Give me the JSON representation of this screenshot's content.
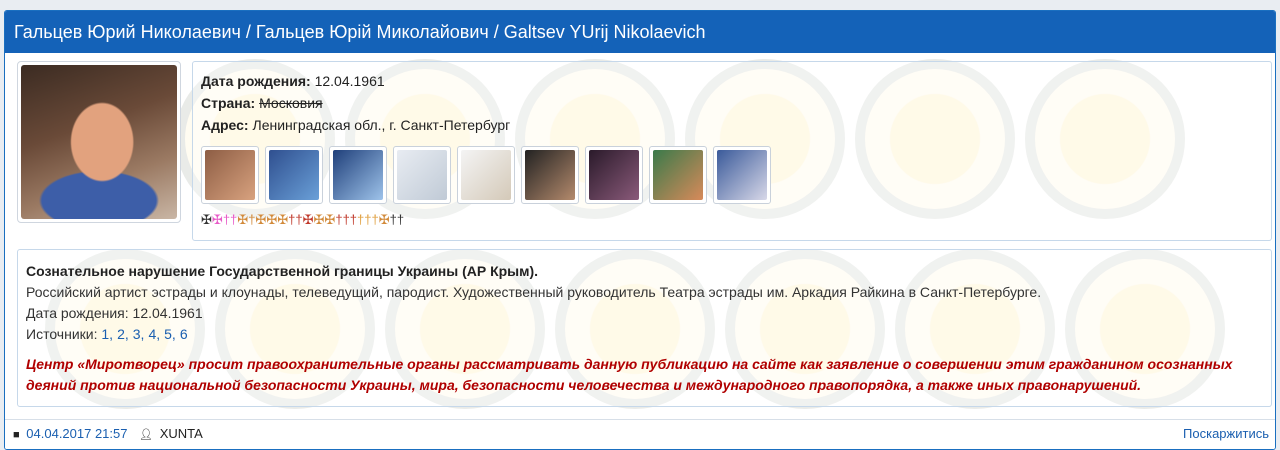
{
  "header": {
    "title": "Гальцев Юрий Николаевич / Гальцев Юрій Миколайович / Galtsev YUrij Nikolaevich"
  },
  "profile": {
    "birth_label": "Дата рождения:",
    "birth_value": "12.04.1961",
    "country_label": "Страна:",
    "country_value": "Московия",
    "address_label": "Адрес:",
    "address_value": "Ленинградская обл., г. Санкт-Петербург"
  },
  "thumbnails": [
    {
      "name": "photo-thumb-1",
      "color_a": "#8d5d44",
      "color_b": "#d8a27f"
    },
    {
      "name": "photo-thumb-2",
      "color_a": "#2f4f8f",
      "color_b": "#6aa0d8"
    },
    {
      "name": "photo-thumb-3",
      "color_a": "#1f3f7a",
      "color_b": "#9ec3ea"
    },
    {
      "name": "doc-thumb-4",
      "color_a": "#e8ecf2",
      "color_b": "#c0cad6"
    },
    {
      "name": "doc-thumb-5",
      "color_a": "#f4f4f4",
      "color_b": "#d4c9b8"
    },
    {
      "name": "photo-thumb-6",
      "color_a": "#222222",
      "color_b": "#b48a6c"
    },
    {
      "name": "photo-thumb-7",
      "color_a": "#2a1a2a",
      "color_b": "#8a5a7a"
    },
    {
      "name": "photo-thumb-8",
      "color_a": "#3a7a4a",
      "color_b": "#d88a5a"
    },
    {
      "name": "photo-thumb-9",
      "color_a": "#3a5a9a",
      "color_b": "#d8d8e8"
    }
  ],
  "crosses": [
    {
      "c": "✠",
      "color": "#333333"
    },
    {
      "c": "✠",
      "color": "#e85ac8"
    },
    {
      "c": "†",
      "color": "#e85ac8"
    },
    {
      "c": "†",
      "color": "#e85ac8"
    },
    {
      "c": "✠",
      "color": "#d28a3a"
    },
    {
      "c": "†",
      "color": "#d28a3a"
    },
    {
      "c": "✠",
      "color": "#d28a3a"
    },
    {
      "c": "✠",
      "color": "#d28a3a"
    },
    {
      "c": "✠",
      "color": "#d28a3a"
    },
    {
      "c": "†",
      "color": "#c0392b"
    },
    {
      "c": "†",
      "color": "#c0392b"
    },
    {
      "c": "✠",
      "color": "#c0392b"
    },
    {
      "c": "✠",
      "color": "#d28a3a"
    },
    {
      "c": "✠",
      "color": "#d28a3a"
    },
    {
      "c": "†",
      "color": "#c0392b"
    },
    {
      "c": "†",
      "color": "#c0392b"
    },
    {
      "c": "†",
      "color": "#c0392b"
    },
    {
      "c": "†",
      "color": "#e0a040"
    },
    {
      "c": "†",
      "color": "#e0a040"
    },
    {
      "c": "†",
      "color": "#e0a040"
    },
    {
      "c": "✠",
      "color": "#d28a3a"
    },
    {
      "c": "†",
      "color": "#333333"
    },
    {
      "c": "†",
      "color": "#333333"
    }
  ],
  "description": {
    "title": "Сознательное нарушение Государственной границы Украины (АР Крым).",
    "bio": "Российский артист эстрады и клоунады, телеведущий, пародист. Художественный руководитель Театра эстрады им. Аркадия Райкина в Санкт-Петербурге.",
    "birth": "Дата рождения: 12.04.1961",
    "sources_label": "Источники:",
    "sources": [
      "1",
      "2",
      "3",
      "4",
      "5",
      "6"
    ],
    "warning": "Центр «Миротворец» просит правоохранительные органы рассматривать данную публикацию на сайте как заявление о совершении этим гражданином осознанных деяний против национальной безопасности Украины, мира, безопасности человечества и международного правопорядка, а также иных правонарушений."
  },
  "footer": {
    "date": "04.04.2017 21:57",
    "author": "XUNTA",
    "complain": "Поскаржитись"
  },
  "colors": {
    "header_bg": "#1462b8",
    "link": "#1a5fb0",
    "warning": "#b00000"
  }
}
